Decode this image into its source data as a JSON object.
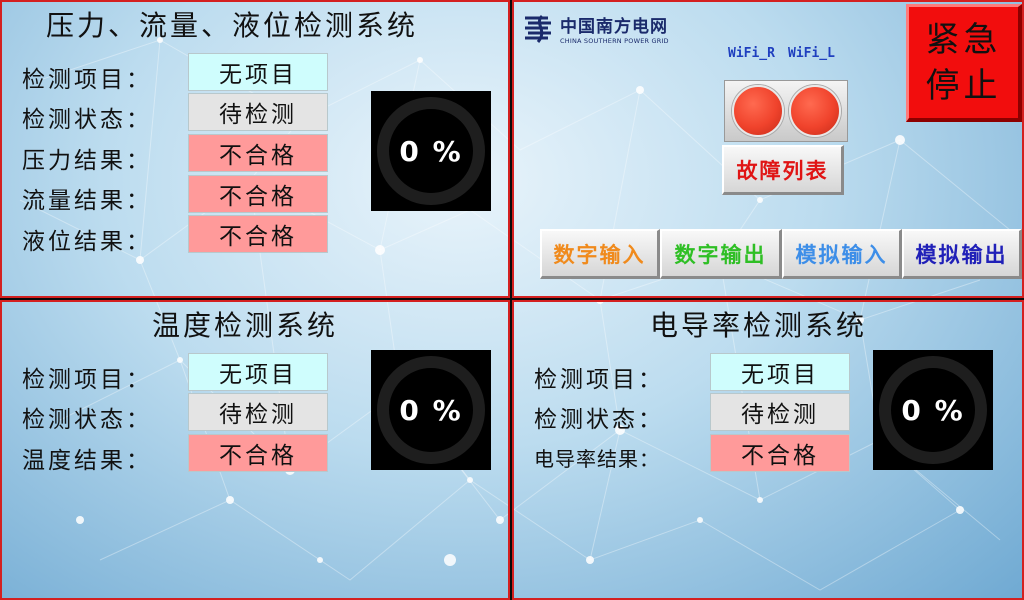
{
  "pressure_panel": {
    "title": "压力、流量、液位检测系统",
    "rows": [
      {
        "label": "检测项目：",
        "value": "无项目",
        "color": "#cffdfd"
      },
      {
        "label": "检测状态：",
        "value": "待检测",
        "color": "#e4e4e4"
      },
      {
        "label": "压力结果：",
        "value": "不合格",
        "color": "#ff9a9a"
      },
      {
        "label": "流量结果：",
        "value": "不合格",
        "color": "#ff9a9a"
      },
      {
        "label": "液位结果：",
        "value": "不合格",
        "color": "#ff9a9a"
      }
    ],
    "progress": "0 %"
  },
  "control_panel": {
    "logo_cn": "中国南方电网",
    "logo_en": "CHINA SOUTHERN POWER GRID",
    "wifi_r": "WiFi_R",
    "wifi_l": "WiFi_L",
    "fault_list": "故障列表",
    "emergency_stop_line1": "紧急",
    "emergency_stop_line2": "停止",
    "buttons": [
      {
        "label": "数字输入",
        "color": "#f08a1c"
      },
      {
        "label": "数字输出",
        "color": "#2fbf25"
      },
      {
        "label": "模拟输入",
        "color": "#3d8ee8"
      },
      {
        "label": "模拟输出",
        "color": "#2020b8"
      }
    ],
    "fault_color": "#e01414",
    "lamp_color": "#f0432c"
  },
  "temperature_panel": {
    "title": "温度检测系统",
    "rows": [
      {
        "label": "检测项目：",
        "value": "无项目",
        "color": "#cffdfd"
      },
      {
        "label": "检测状态：",
        "value": "待检测",
        "color": "#e4e4e4"
      },
      {
        "label": "温度结果：",
        "value": "不合格",
        "color": "#ff9a9a"
      }
    ],
    "progress": "0 %"
  },
  "conductivity_panel": {
    "title": "电导率检测系统",
    "rows": [
      {
        "label": "检测项目：",
        "value": "无项目",
        "color": "#cffdfd"
      },
      {
        "label": "检测状态：",
        "value": "待检测",
        "color": "#e4e4e4"
      },
      {
        "label": "电导率结果：",
        "value": "不合格",
        "color": "#ff9a9a"
      }
    ],
    "progress": "0 %"
  }
}
